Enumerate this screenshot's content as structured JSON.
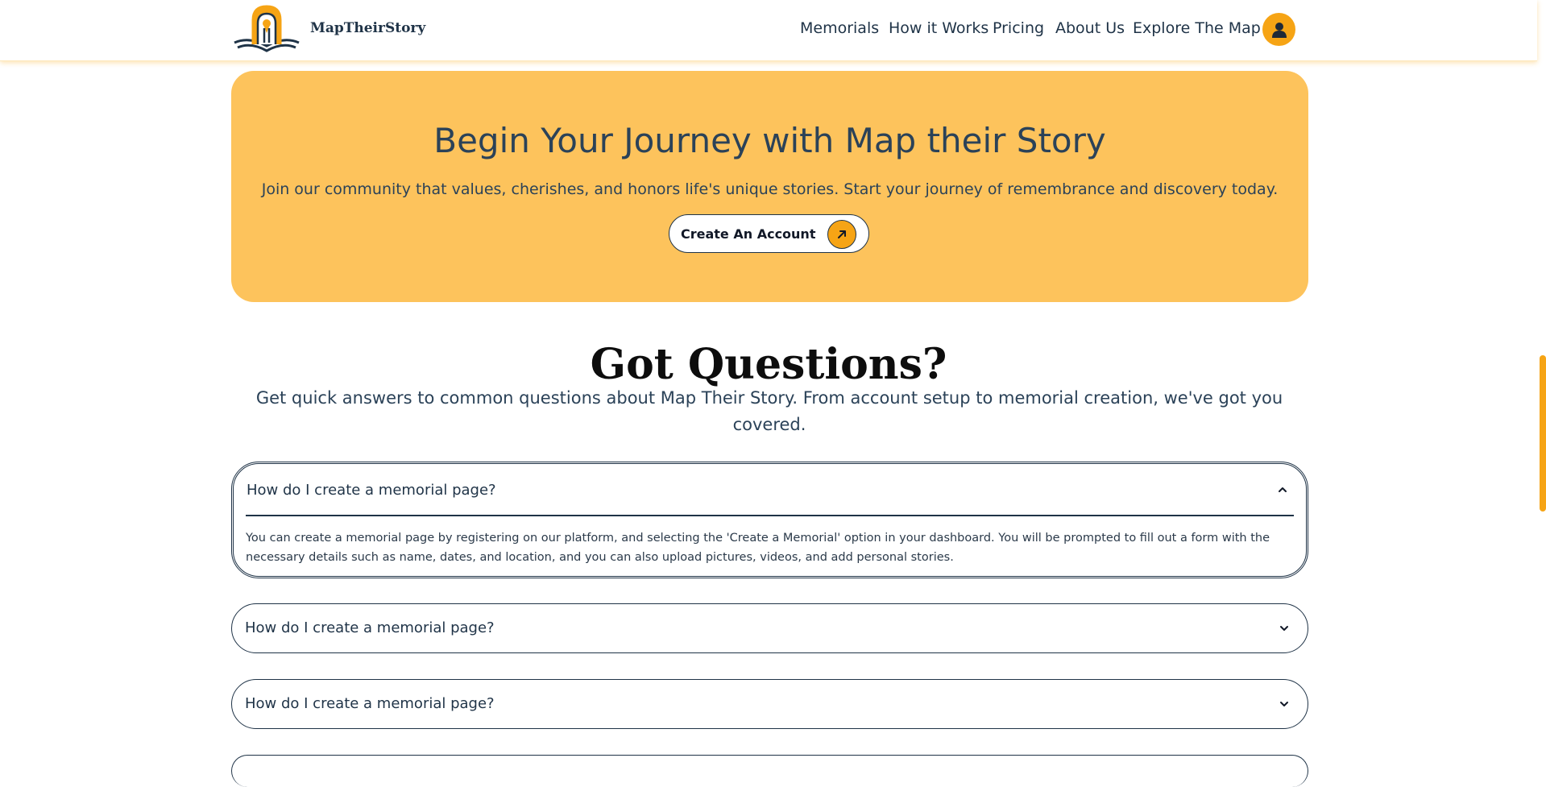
{
  "header": {
    "brand": "MapTheirStory",
    "nav": [
      "Memorials",
      "How it Works",
      "Pricing",
      "About Us",
      "Explore The Map"
    ],
    "avatar_icon": "user-icon",
    "accent": "#f6a415"
  },
  "cta": {
    "title": "Begin Your Journey with Map their Story",
    "subtitle": "Join our community that values, cherishes, and honors life's unique stories. Start your journey of remembrance and discovery today.",
    "button_label": "Create An Account",
    "button_icon": "arrow-up-right-icon",
    "background": "#fdc35c"
  },
  "faq": {
    "title": "Got Questions?",
    "subtitle": "Get quick answers to common questions about Map Their Story. From account setup to memorial creation, we've got you covered.",
    "items": [
      {
        "question": "How do I create a memorial page?",
        "answer": "You can create a memorial page by registering on our platform, and selecting the 'Create a Memorial' option in your dashboard. You will be prompted to fill out a form with the necessary details such as name, dates, and location, and you can also upload pictures, videos, and add personal stories.",
        "expanded": true
      },
      {
        "question": "How do I create a memorial page?",
        "expanded": false
      },
      {
        "question": "How do I create a memorial page?",
        "expanded": false
      }
    ]
  }
}
